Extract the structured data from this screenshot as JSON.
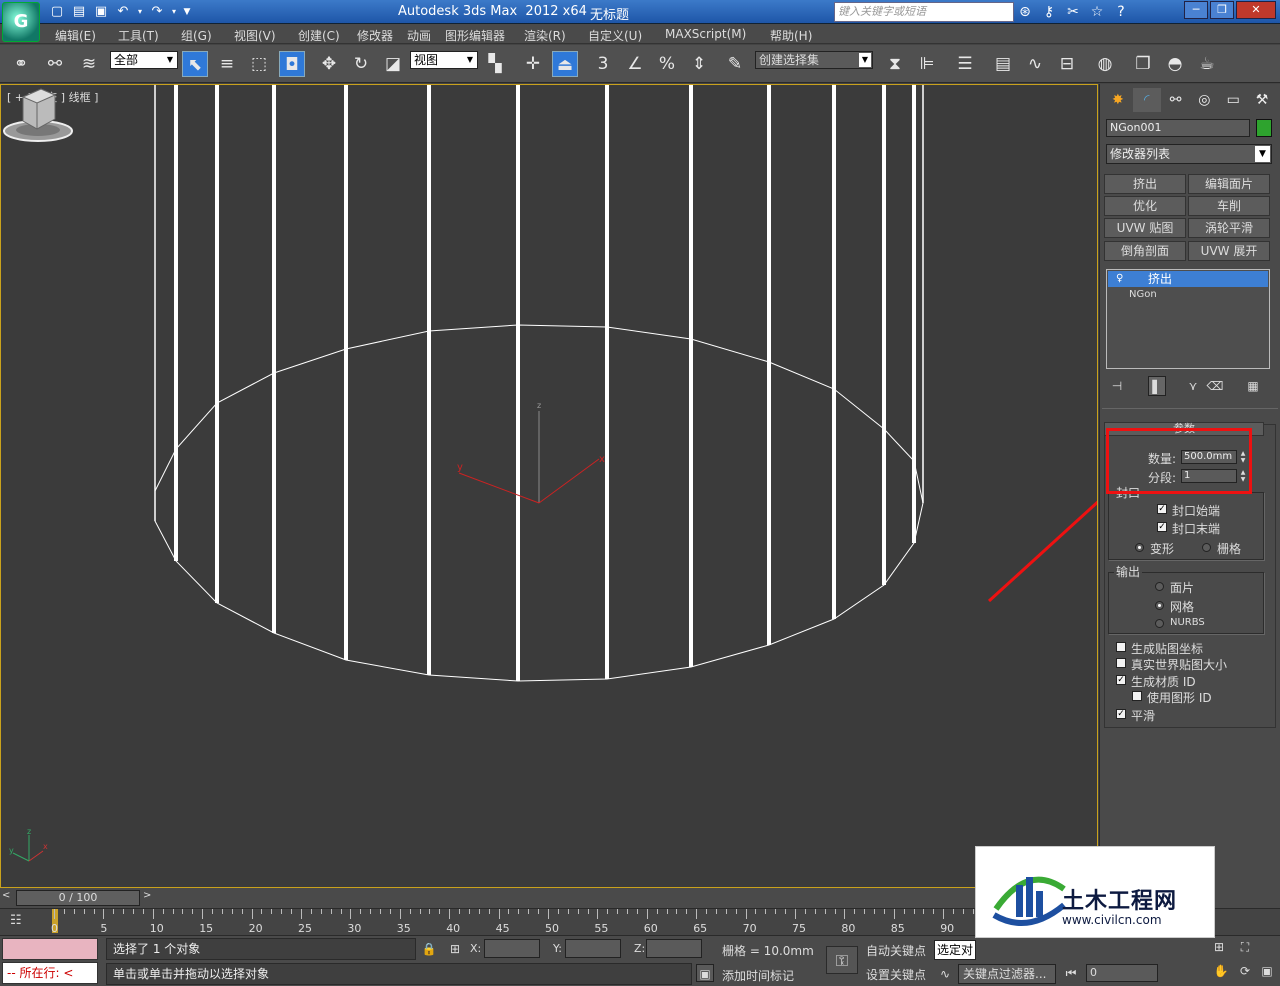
{
  "window": {
    "title": "Autodesk 3ds Max  2012 x64",
    "document": "无标题",
    "search_placeholder": "键入关键字或短语",
    "minimize": "─",
    "restore": "❐",
    "close": "✕",
    "logo": "G"
  },
  "menu": {
    "items": [
      "编辑(E)",
      "工具(T)",
      "组(G)",
      "视图(V)",
      "创建(C)",
      "修改器",
      "动画",
      "图形编辑器",
      "渲染(R)",
      "自定义(U)",
      "MAXScript(M)",
      "帮助(H)"
    ]
  },
  "toolbar": {
    "filter_value": "全部",
    "refcoord_value": "视图",
    "snap_3": "3",
    "named_selection_placeholder": "创建选择集"
  },
  "viewport": {
    "label": "[ + ] 正交 ] 线框 ]",
    "axis_x": "x",
    "axis_y": "y",
    "axis_z": "z"
  },
  "command_panel": {
    "object_name": "NGon001",
    "object_color": "#2ea32e",
    "modifier_list": "修改器列表",
    "modifier_buttons": [
      "挤出",
      "编辑面片",
      "优化",
      "车削",
      "UVW 贴图",
      "涡轮平滑",
      "倒角剖面",
      "UVW 展开"
    ],
    "stack": [
      "挤出",
      "NGon"
    ],
    "rollout_title": "参数",
    "amount_label": "数量:",
    "amount_value": "500.0mm",
    "segments_label": "分段:",
    "segments_value": "1",
    "capping_title": "封口",
    "cap_start": "封口始端",
    "cap_end": "封口末端",
    "morph": "变形",
    "grid": "栅格",
    "output_title": "输出",
    "out_patch": "面片",
    "out_mesh": "网格",
    "out_nurbs": "NURBS",
    "gen_map": "生成贴图坐标",
    "real_world": "真实世界贴图大小",
    "gen_mat": "生成材质 ID",
    "use_shape": "使用图形 ID",
    "smooth": "平滑"
  },
  "timeline": {
    "position": "0 / 100",
    "ticks": [
      "0",
      "5",
      "10",
      "15",
      "20",
      "25",
      "30",
      "35",
      "40",
      "45",
      "50",
      "55",
      "60",
      "65",
      "70",
      "75",
      "80",
      "85",
      "90"
    ]
  },
  "status": {
    "listener": "-- 所在行: <",
    "selection": "选择了 1 个对象",
    "prompt": "单击或单击并拖动以选择对象",
    "x_label": "X:",
    "y_label": "Y:",
    "z_label": "Z:",
    "grid": "栅格 = 10.0mm",
    "add_time_tag": "添加时间标记",
    "auto_key": "自动关键点",
    "selected": "选定对",
    "set_key": "设置关键点",
    "key_filters": "关键点过滤器...",
    "frame": "0"
  },
  "watermark": {
    "brand": "土木工程网",
    "url": "www.civilcn.com"
  },
  "colors": {
    "accent": "#2f79d8",
    "annotation": "#e11111",
    "viewport_border": "#c9a21c"
  }
}
